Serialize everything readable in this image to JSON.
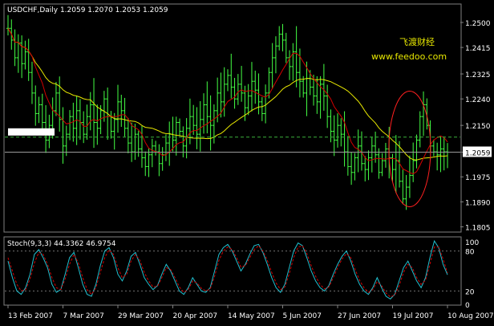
{
  "chart_data": [
    {
      "type": "line",
      "subtype": "ohlc-bars",
      "symbol_header": "USDCHF,Daily  1.2059 1.2070 1.2053 1.2059",
      "watermark": {
        "name": "飞渡财经",
        "url": "www.feedoo.com"
      },
      "current_price_label": "1.2059",
      "current_price": 1.2059,
      "dashed_level": 1.211,
      "ylim": [
        1.179,
        1.256
      ],
      "y_ticks": [
        "1.2500",
        "1.2415",
        "1.2325",
        "1.2240",
        "1.2150",
        "1.2059",
        "1.1975",
        "1.1890",
        "1.1805"
      ],
      "y_tick_values": [
        1.25,
        1.2415,
        1.2325,
        1.224,
        1.215,
        1.2059,
        1.1975,
        1.189,
        1.1805
      ],
      "x_ticks": [
        "13 Feb 2007",
        "7 Mar 2007",
        "29 Mar 2007",
        "20 Apr 2007",
        "14 May 2007",
        "5 Jun 2007",
        "27 Jun 2007",
        "19 Jul 2007",
        "10 Aug 2007"
      ],
      "x_tick_bar_index": [
        0,
        16,
        32,
        48,
        64,
        80,
        96,
        112,
        128
      ],
      "price_closes": [
        1.248,
        1.244,
        1.238,
        1.243,
        1.236,
        1.24,
        1.233,
        1.226,
        1.219,
        1.222,
        1.216,
        1.21,
        1.215,
        1.22,
        1.226,
        1.217,
        1.208,
        1.212,
        1.218,
        1.214,
        1.22,
        1.216,
        1.212,
        1.218,
        1.222,
        1.216,
        1.214,
        1.22,
        1.224,
        1.218,
        1.213,
        1.217,
        1.223,
        1.22,
        1.214,
        1.209,
        1.206,
        1.212,
        1.207,
        1.204,
        1.201,
        1.205,
        1.208,
        1.206,
        1.202,
        1.205,
        1.209,
        1.212,
        1.21,
        1.216,
        1.213,
        1.208,
        1.214,
        1.218,
        1.215,
        1.212,
        1.217,
        1.222,
        1.218,
        1.215,
        1.22,
        1.226,
        1.223,
        1.229,
        1.232,
        1.228,
        1.224,
        1.229,
        1.226,
        1.221,
        1.225,
        1.23,
        1.227,
        1.223,
        1.219,
        1.226,
        1.233,
        1.238,
        1.242,
        1.246,
        1.244,
        1.238,
        1.235,
        1.24,
        1.233,
        1.23,
        1.226,
        1.231,
        1.228,
        1.225,
        1.223,
        1.229,
        1.225,
        1.218,
        1.213,
        1.21,
        1.215,
        1.212,
        1.206,
        1.201,
        1.199,
        1.204,
        1.208,
        1.202,
        1.2,
        1.204,
        1.208,
        1.205,
        1.199,
        1.203,
        1.207,
        1.204,
        1.2,
        1.203,
        1.196,
        1.19,
        1.194,
        1.198,
        1.203,
        1.21,
        1.218,
        1.222,
        1.215,
        1.208,
        1.206,
        1.205,
        1.207,
        1.206,
        1.2059
      ],
      "series": [
        {
          "name": "",
          "color": "#d40000",
          "kind": "moving-average-fast"
        },
        {
          "name": "",
          "color": "#e8e800",
          "kind": "moving-average-slow"
        }
      ],
      "highlight": {
        "shape": "ellipse",
        "color": "#ff2020",
        "around": "last swing high/low in Aug 2007"
      },
      "grid": false
    },
    {
      "type": "line",
      "title": "Stoch(9,3,3) 44.3362 46.9754",
      "ylim": [
        0,
        100
      ],
      "y_ticks": [
        "100",
        "80",
        "20",
        "0"
      ],
      "y_tick_values": [
        100,
        80,
        20,
        0
      ],
      "levels": [
        80,
        20
      ],
      "series": [
        {
          "name": "",
          "color": "#20c0d0",
          "style": "solid",
          "values": [
            65,
            40,
            20,
            15,
            25,
            45,
            75,
            82,
            70,
            55,
            30,
            18,
            22,
            45,
            70,
            78,
            55,
            30,
            15,
            12,
            30,
            58,
            80,
            85,
            70,
            45,
            35,
            50,
            72,
            78,
            60,
            40,
            30,
            22,
            28,
            45,
            60,
            50,
            35,
            20,
            15,
            25,
            40,
            30,
            20,
            18,
            25,
            50,
            75,
            85,
            90,
            80,
            65,
            50,
            60,
            75,
            88,
            90,
            78,
            60,
            40,
            25,
            18,
            30,
            55,
            80,
            92,
            88,
            70,
            50,
            35,
            25,
            20,
            28,
            45,
            60,
            72,
            80,
            65,
            45,
            30,
            20,
            15,
            25,
            40,
            25,
            12,
            8,
            15,
            35,
            55,
            65,
            50,
            35,
            25,
            40,
            70,
            95,
            85,
            60,
            44.34
          ]
        },
        {
          "name": "",
          "color": "#d40000",
          "style": "dashed",
          "values": [
            70,
            50,
            30,
            20,
            22,
            38,
            62,
            78,
            75,
            60,
            40,
            25,
            22,
            38,
            60,
            75,
            62,
            40,
            22,
            15,
            25,
            48,
            70,
            82,
            75,
            55,
            40,
            45,
            65,
            75,
            66,
            48,
            35,
            26,
            27,
            40,
            55,
            52,
            40,
            26,
            18,
            22,
            35,
            32,
            24,
            20,
            23,
            42,
            66,
            80,
            86,
            82,
            70,
            56,
            58,
            70,
            82,
            88,
            80,
            66,
            48,
            32,
            22,
            26,
            46,
            70,
            86,
            88,
            76,
            58,
            42,
            30,
            23,
            26,
            40,
            55,
            68,
            76,
            70,
            52,
            36,
            25,
            18,
            22,
            34,
            28,
            17,
            11,
            14,
            28,
            48,
            60,
            55,
            40,
            30,
            36,
            60,
            86,
            86,
            68,
            46.98
          ]
        }
      ],
      "grid": false
    }
  ]
}
